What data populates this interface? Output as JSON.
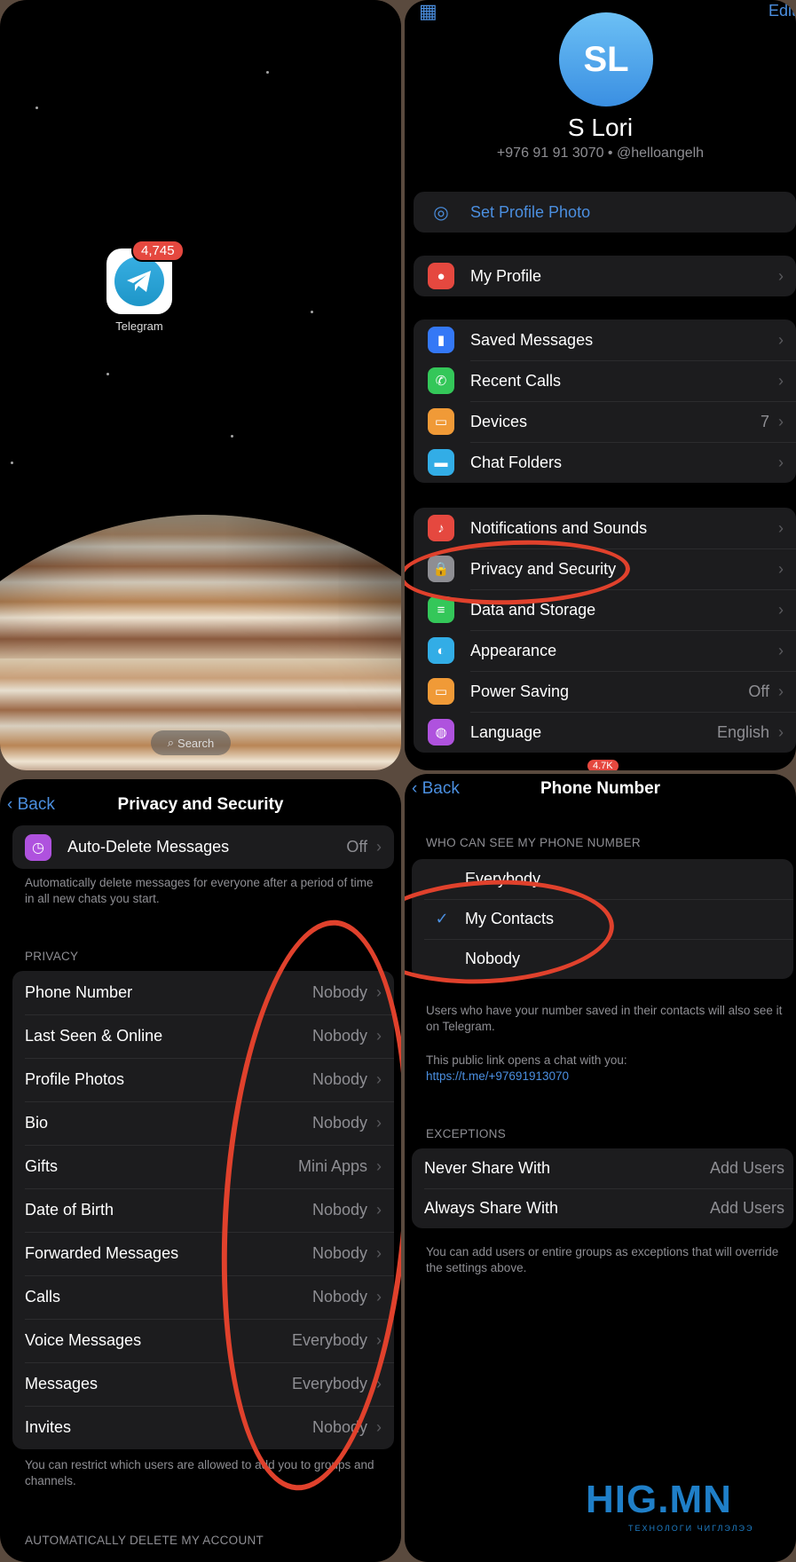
{
  "home": {
    "app_label": "Telegram",
    "badge": "4,745",
    "search_label": "Search"
  },
  "settings": {
    "edit": "Edit",
    "avatar_initials": "SL",
    "name": "S Lori",
    "subtitle": "+976 91 91 3070 • @helloangelh",
    "set_photo": "Set Profile Photo",
    "my_profile": "My Profile",
    "group2": [
      {
        "label": "Saved Messages",
        "value": "",
        "color": "#3478f6",
        "icon": "bookmark-icon",
        "glyph": "▮"
      },
      {
        "label": "Recent Calls",
        "value": "",
        "color": "#34c759",
        "icon": "phone-icon",
        "glyph": "✆"
      },
      {
        "label": "Devices",
        "value": "7",
        "color": "#f09a37",
        "icon": "devices-icon",
        "glyph": "▭"
      },
      {
        "label": "Chat Folders",
        "value": "",
        "color": "#32ade6",
        "icon": "folder-icon",
        "glyph": "▬"
      }
    ],
    "group3": [
      {
        "label": "Notifications and Sounds",
        "value": "",
        "color": "#e5483f",
        "icon": "bell-icon",
        "glyph": "♪"
      },
      {
        "label": "Privacy and Security",
        "value": "",
        "color": "#8e8e93",
        "icon": "lock-icon",
        "glyph": "🔒"
      },
      {
        "label": "Data and Storage",
        "value": "",
        "color": "#34c759",
        "icon": "database-icon",
        "glyph": "≡"
      },
      {
        "label": "Appearance",
        "value": "",
        "color": "#32ade6",
        "icon": "appearance-icon",
        "glyph": "◐"
      },
      {
        "label": "Power Saving",
        "value": "Off",
        "color": "#f09a37",
        "icon": "battery-icon",
        "glyph": "▭"
      },
      {
        "label": "Language",
        "value": "English",
        "color": "#af52de",
        "icon": "globe-icon",
        "glyph": "◍"
      }
    ],
    "tab_badge": "4.7K"
  },
  "privacy": {
    "back": "Back",
    "title": "Privacy and Security",
    "auto_delete": {
      "label": "Auto-Delete Messages",
      "value": "Off"
    },
    "auto_delete_caption": "Automatically delete messages for everyone after a period of time in all new chats you start.",
    "section_privacy": "PRIVACY",
    "rows": [
      {
        "label": "Phone Number",
        "value": "Nobody"
      },
      {
        "label": "Last Seen & Online",
        "value": "Nobody"
      },
      {
        "label": "Profile Photos",
        "value": "Nobody"
      },
      {
        "label": "Bio",
        "value": "Nobody"
      },
      {
        "label": "Gifts",
        "value": "Mini Apps"
      },
      {
        "label": "Date of Birth",
        "value": "Nobody"
      },
      {
        "label": "Forwarded Messages",
        "value": "Nobody"
      },
      {
        "label": "Calls",
        "value": "Nobody"
      },
      {
        "label": "Voice Messages",
        "value": "Everybody"
      },
      {
        "label": "Messages",
        "value": "Everybody"
      },
      {
        "label": "Invites",
        "value": "Nobody"
      }
    ],
    "invites_caption": "You can restrict which users are allowed to add you to groups and channels.",
    "section_auto_delete": "AUTOMATICALLY DELETE MY ACCOUNT"
  },
  "phone": {
    "back": "Back",
    "title": "Phone Number",
    "section_who": "WHO CAN SEE MY PHONE NUMBER",
    "options": [
      {
        "label": "Everybody",
        "checked": false
      },
      {
        "label": "My Contacts",
        "checked": true
      },
      {
        "label": "Nobody",
        "checked": false
      }
    ],
    "caption1": "Users who have your number saved in their contacts will also see it on Telegram.",
    "caption2": "This public link opens a chat with you:",
    "link": "https://t.me/+97691913070",
    "section_exceptions": "EXCEPTIONS",
    "exceptions": [
      {
        "label": "Never Share With",
        "value": "Add Users"
      },
      {
        "label": "Always Share With",
        "value": "Add Users"
      }
    ],
    "exceptions_caption": "You can add users or entire groups as exceptions that will override the settings above."
  },
  "watermark": {
    "text": "HIG.MN",
    "sub": "ТЕХНОЛОГИ ЧИГЛЭЛЭЭ"
  },
  "colors": {
    "accent": "#4b8fe0",
    "highlight": "#e0412c",
    "panel_bg": "#1c1c1e"
  }
}
